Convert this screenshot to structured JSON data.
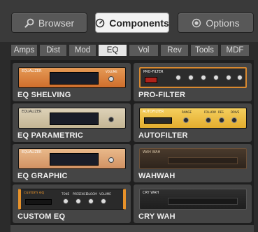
{
  "toolbar": {
    "browser": {
      "label": "Browser",
      "icon": "search-icon"
    },
    "components": {
      "label": "Components",
      "icon": "timer-icon"
    },
    "options": {
      "label": "Options",
      "icon": "radio-icon"
    }
  },
  "tabs": [
    {
      "label": "Amps"
    },
    {
      "label": "Dist"
    },
    {
      "label": "Mod"
    },
    {
      "label": "EQ"
    },
    {
      "label": "Vol"
    },
    {
      "label": "Rev"
    },
    {
      "label": "Tools"
    },
    {
      "label": "MDF"
    }
  ],
  "selected_tab": "EQ",
  "components": [
    {
      "label": "EQ SHELVING",
      "thumb_title": "Equalizer",
      "thumb_label": "Volume"
    },
    {
      "label": "PRO-FILTER",
      "thumb_title": "Pro-Filter"
    },
    {
      "label": "EQ PARAMETRIC",
      "thumb_title": "Equalizer"
    },
    {
      "label": "AUTOFILTER",
      "thumb_title": "Autofilter",
      "thumb_knobs": [
        "Range",
        "Follow",
        "Res",
        "Drive"
      ]
    },
    {
      "label": "EQ GRAPHIC",
      "thumb_title": "Equalizer"
    },
    {
      "label": "WAHWAH",
      "thumb_title": "Wah Wah"
    },
    {
      "label": "CUSTOM EQ",
      "thumb_title": "custom eq",
      "thumb_knobs": [
        "Tone",
        "Presence",
        "Bloom",
        "Volume"
      ]
    },
    {
      "label": "CRY WAH",
      "thumb_title": "Cry Wah"
    }
  ],
  "colors": {
    "accent_orange": "#e0823a",
    "eq_cream": "#d6c9ad",
    "autofilter_yellow": "#f0c24a",
    "panel_dark": "#1f1f1f"
  }
}
